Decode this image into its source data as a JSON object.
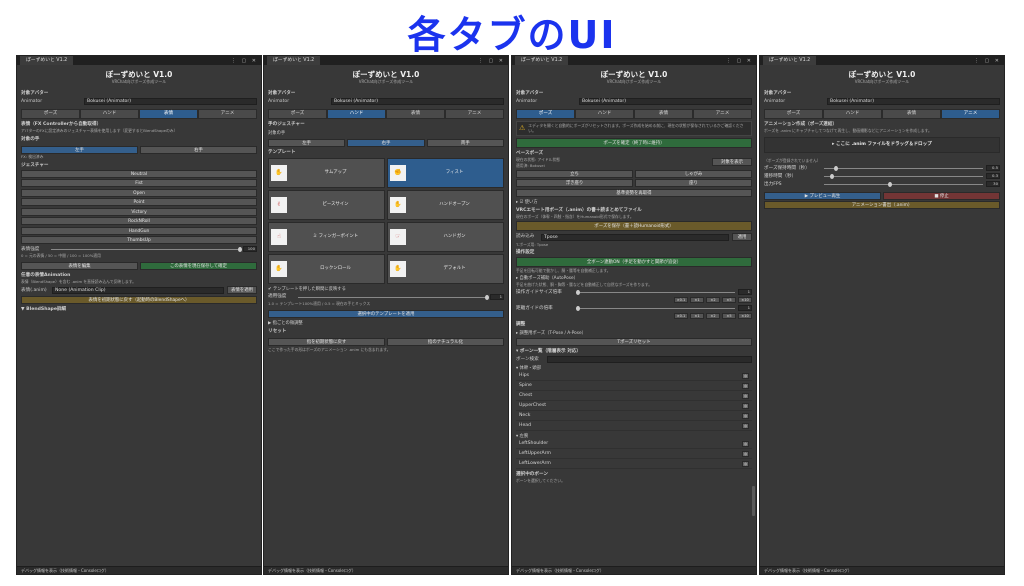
{
  "hero_title": "各タブのUI",
  "common": {
    "tab_label": "ぽーずめいと V1.2",
    "app_title": "ぽーずめいと V1.0",
    "app_sub": "VRChat向けポーズ作成ツール",
    "target_avatar_label": "対象アバター",
    "animator_label": "Animator",
    "animator_value": "Bokusei (Animator)",
    "tabs": [
      "ポーズ",
      "ハンド",
      "表情",
      "アニメ"
    ],
    "footer": "デバッグ情報を表示（技術情報・Consoleログ）",
    "win_ctrl": "⋮ ▢ ✕"
  },
  "panel_expression": {
    "section_title": "表情（FX Controllerから自動取得）",
    "section_note": "アバターのFXに設定済みのジェスチャー表情を使用します（変更するとBlendShapeのみ）",
    "target_hand": "対象の手",
    "hand_left": "左手",
    "hand_right": "右手",
    "fx_note": "FX: 検出済み",
    "gesture_label": "ジェスチャー",
    "gestures": [
      "Neutral",
      "Fist",
      "Open",
      "Point",
      "Victory",
      "RockNRoll",
      "HandGun",
      "ThumbsUp"
    ],
    "strength_label": "表情強度",
    "strength_value": "100",
    "strength_note": "0 = 元の表情 / 50 = 中間 / 100 = 100%適用",
    "btn_edit": "表情を編集",
    "btn_save": "この表情を現在保存して確定",
    "anim_title": "任意の表情Animation",
    "anim_note": "表情（BlendShape）を含む .anim を直接読み込んで反映します。",
    "anim_clip_label": "表情(.anim)",
    "anim_clip_value": "None (Animation Clip)",
    "anim_apply": "表情を適用",
    "btn_restore": "表情を初期状態に戻す（起動時のBlendShapeへ）",
    "blendshape_detail": "▼ BlendShape詳細"
  },
  "panel_hand": {
    "section_title": "手のジェスチャー",
    "target_hand": "対象の手",
    "hands": [
      "左手",
      "右手",
      "両手"
    ],
    "template_label": "テンプレート",
    "templates": [
      "サムアップ",
      "フィスト",
      "ピースサイン",
      "ハンドオープン",
      "ミ フィンガーポイント",
      "ハンドガン",
      "ロックンロール",
      "デフォルト"
    ],
    "apply_check": "✔ テンプレートを押した瞬間に反映する",
    "blend_label": "適用強度",
    "blend_value": "1",
    "blend_note": "1.0 = テンプレート100%適用 / 0.5 = 現在の手とミックス",
    "btn_apply_selected": "選択中のテンプレートを適用",
    "finger_detail": "▶ 指ごとの微調整",
    "reset_label": "リセット",
    "btn_reset_initial": "指を初期状態に戻す",
    "btn_reset_natural": "指のナチュラル化",
    "reset_note": "ここで作った手の形はポーズのアニメーション .anim にも含まれます。"
  },
  "panel_pose": {
    "warn_text": "エディタを開くと自動的にポーズがリセットされます。ポーズ作成を始める前に、現在の状態が保存されているかご確認ください。",
    "btn_confirm": "ポーズを確定（終了時に維持）",
    "base_pose": "ベースポーズ",
    "base_note1": "現在の状態: アイドル状態",
    "base_note2": "適用済: Bokusei",
    "btn_show_target": "対象を表示",
    "btn_stand": "立ち",
    "btn_crouch": "しゃがみ",
    "btn_sit_float": "浮き座り",
    "btn_prone": "座り",
    "btn_select_base": "基準姿勢を再取得",
    "use_check": "▸ ☑ 使い方",
    "vrc_title": "VRCエモート用ポーズ（.anim）の書＋読まとめてファイル",
    "vrc_note": "現在のポーズ（体幹・四肢・指含）をHumanoid形式で保存します。",
    "btn_save_pose": "ポーズを保存（書＋読Humanoid形式）",
    "load_label": "読み込み",
    "load_value": "Tpose",
    "load_apply": "適用",
    "tpose_note": "T-ポーズ用: Tpose",
    "operation_label": "操作設定",
    "btn_all_bones": "全ボーン連動ON（手足を動かすと関節が追従）",
    "op_note": "手足を回転可能で動かし、胴・腰等を自動補正します。",
    "auto_pose": "▸ 自動ポーズ補助（AutoPose）",
    "auto_note": "手足を曲げた状態、胴・胸等・腰などを自動補正して自然なポーズを作ります。",
    "rot_label": "操作ガイドサイズ倍率",
    "rot_value": "1",
    "dist_label": "距離ガイドの倍率",
    "dist_value": "1",
    "steps": [
      "×0.1",
      "×1",
      "×2",
      "×5",
      "×10"
    ],
    "adjust_label": "調整",
    "adjust_pose": "▸ 調整用ポーズ（T-Pose / A-Pose）",
    "btn_t_reset": "Tポーズリセット",
    "bone_list_title": "▾ ボーン一覧（階層表示 対応）",
    "bone_search": "ボーン検索",
    "group_core": "▾ 体幹・頭部",
    "bones_core": [
      "Hips",
      "Spine",
      "Chest",
      "UpperChest",
      "Neck",
      "Head"
    ],
    "group_arm": "▾ 左腕",
    "bones_arm": [
      "LeftShoulder",
      "LeftUpperArm",
      "LeftLowerArm"
    ],
    "selected_bone": "選択中のボーン",
    "selected_note": "ボーンを選択してください。"
  },
  "panel_anim": {
    "section_title": "アニメーション作成（ポーズ連結）",
    "section_note": "ポーズを .anim にキャプチャしてつなげて再生し、動画撮影などにアニメーションを作成します。",
    "drop_label": "▸ ここに .anim ファイルをドラッグ＆ドロップ",
    "hint": "（ポーズが登録されていません）",
    "rows": [
      {
        "label": "ポーズ保持時間（秒）",
        "value": "0.5",
        "fill": 0.06
      },
      {
        "label": "遷移時間（秒）",
        "value": "0.3",
        "fill": 0.04
      },
      {
        "label": "出力FPS",
        "value": "30",
        "fill": 0.4
      }
    ],
    "btn_preview": "▶ プレビュー再生",
    "btn_stop": "■ 停止",
    "btn_export": "アニメーション書出（.anim）"
  }
}
